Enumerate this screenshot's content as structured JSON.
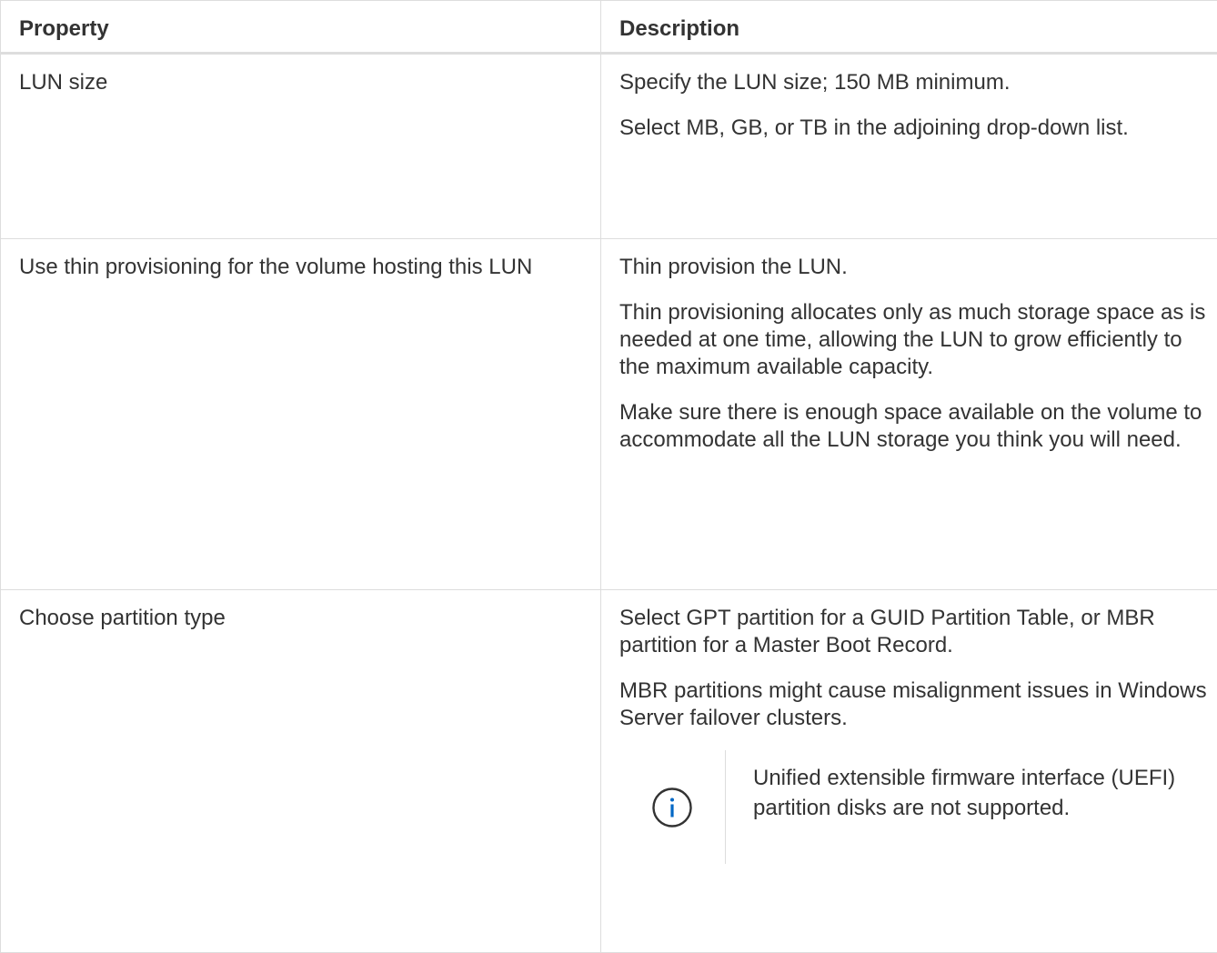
{
  "table": {
    "headers": {
      "property": "Property",
      "description": "Description"
    },
    "rows": [
      {
        "property": "LUN size",
        "description": [
          "Specify the LUN size; 150 MB minimum.",
          "Select MB, GB, or TB in the adjoining drop-down list."
        ]
      },
      {
        "property": "Use thin provisioning for the volume hosting this LUN",
        "description": [
          "Thin provision the LUN.",
          "Thin provisioning allocates only as much storage space as is needed at one time, allowing the LUN to grow efficiently to the maximum available capacity.",
          "Make sure there is enough space available on the volume to accommodate all the LUN storage you think you will need."
        ]
      },
      {
        "property": "Choose partition type",
        "description": [
          "Select GPT partition for a GUID Partition Table, or MBR partition for a Master Boot Record.",
          "MBR partitions might cause misalignment issues in Windows Server failover clusters."
        ],
        "note": {
          "icon": "info-icon",
          "text": "Unified extensible firmware interface (UEFI) partition disks are not supported."
        }
      }
    ]
  },
  "colors": {
    "text": "#333333",
    "border": "#dddddd",
    "info_icon": "#0067c5"
  }
}
